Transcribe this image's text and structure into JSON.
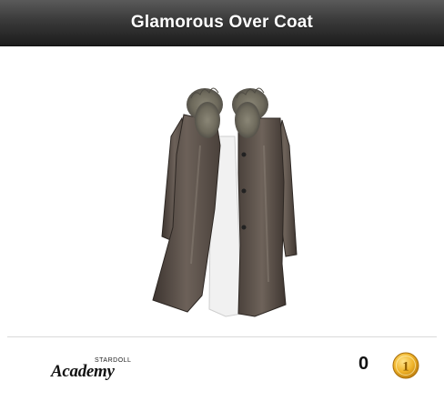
{
  "header": {
    "title": "Glamorous Over Coat"
  },
  "item": {
    "image_icon": "fur-collar-coat-image"
  },
  "footer": {
    "logo_small": "STARDOLL",
    "logo_main": "Academy",
    "coin_count": "0",
    "coin_value": "1",
    "coin_icon": "gold-coin-icon"
  },
  "colors": {
    "header_dark": "#1c1c1c",
    "coat_brown": "#5a4f47",
    "coin_gold": "#e0a51e"
  }
}
